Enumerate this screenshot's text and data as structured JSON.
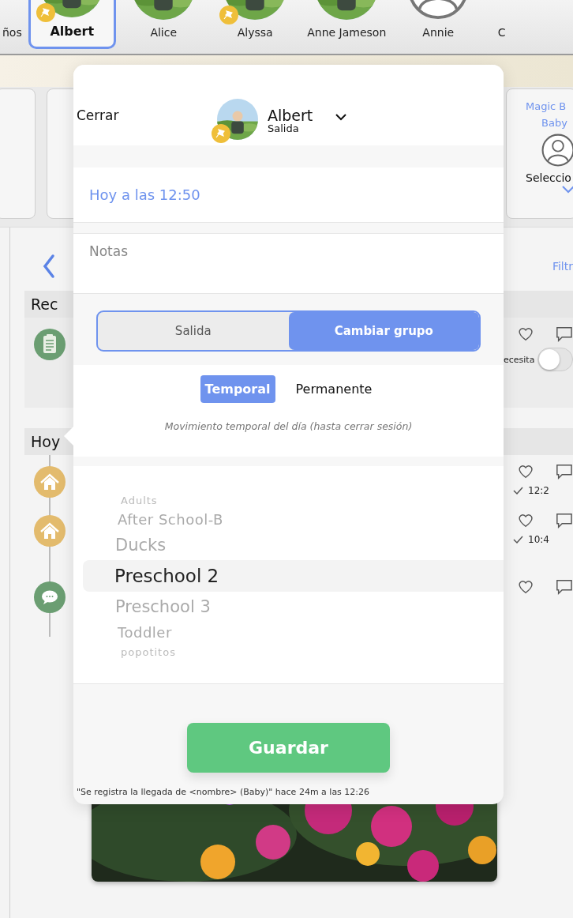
{
  "children_bar": {
    "items": [
      {
        "name": "ños",
        "selected": false,
        "pinned": false,
        "kind": "blank"
      },
      {
        "name": "Albert",
        "selected": true,
        "pinned": true
      },
      {
        "name": "Alice",
        "selected": false,
        "pinned": false
      },
      {
        "name": "Alyssa",
        "selected": false,
        "pinned": true
      },
      {
        "name": "Anne Jameson",
        "selected": false,
        "pinned": false
      },
      {
        "name": "Annie",
        "selected": false,
        "pinned": false,
        "kind": "silhouette"
      },
      {
        "name": "C",
        "selected": false,
        "pinned": false,
        "kind": "blank"
      }
    ]
  },
  "side_card": {
    "lines": [
      "Magic B",
      "Baby"
    ],
    "select_label": "Seleccio"
  },
  "feed": {
    "filter_label": "Filtr",
    "sections": [
      {
        "title": "Rec",
        "entries": [
          {
            "kind": "clipboard",
            "toggle_label": "ecesita",
            "toggle_on": false
          }
        ]
      },
      {
        "title": "Hoy",
        "entries": [
          {
            "kind": "home",
            "time": "12:2"
          },
          {
            "kind": "home",
            "time": "10:4"
          },
          {
            "kind": "chat"
          }
        ]
      }
    ]
  },
  "modal": {
    "close": "Cerrar",
    "child": {
      "name": "Albert",
      "status": "Salida",
      "pinned": true
    },
    "time": "Hoy a las 12:50",
    "notes_placeholder": "Notas",
    "mode_tabs": [
      {
        "label": "Salida",
        "selected": false
      },
      {
        "label": "Cambiar grupo",
        "selected": true
      }
    ],
    "duration_tabs": [
      {
        "label": "Temporal",
        "selected": true
      },
      {
        "label": "Permanente",
        "selected": false
      }
    ],
    "hint": "Movimiento temporal del día (hasta cerrar sesión)",
    "groups": [
      {
        "label": "Adults",
        "selected": false
      },
      {
        "label": "After School-B",
        "selected": false
      },
      {
        "label": "Ducks",
        "selected": false
      },
      {
        "label": "Preschool 2",
        "selected": true
      },
      {
        "label": "Preschool 3",
        "selected": false
      },
      {
        "label": "Toddler",
        "selected": false
      },
      {
        "label": "popotitos",
        "selected": false
      }
    ],
    "save": "Guardar",
    "footnote": "\"Se registra la llegada de <nombre> (Baby)\" hace 24m a las 12:26"
  }
}
